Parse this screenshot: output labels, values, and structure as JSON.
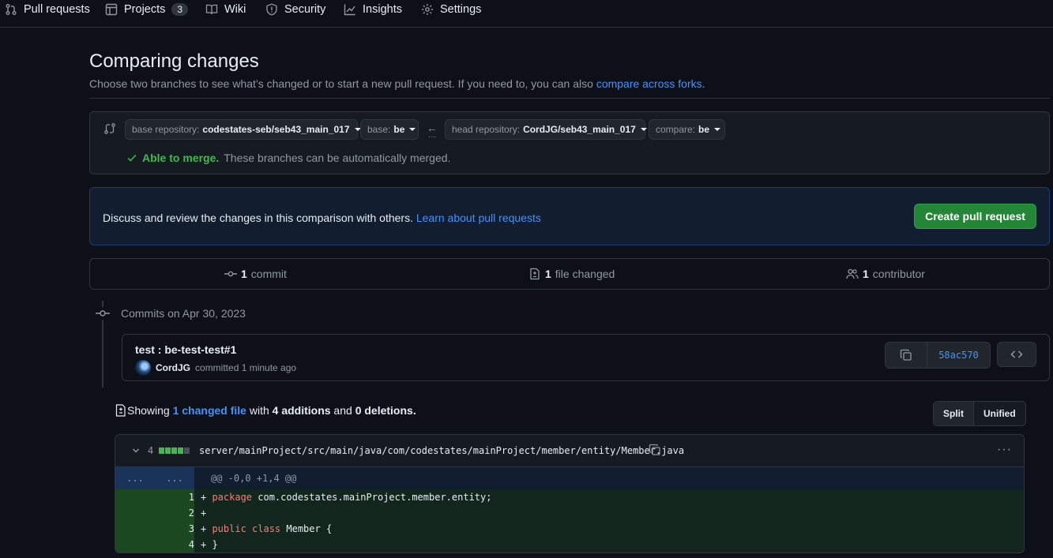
{
  "nav": {
    "items": [
      {
        "label": "Pull requests",
        "icon": "git-pull-request-icon"
      },
      {
        "label": "Projects",
        "icon": "table-icon",
        "count": "3"
      },
      {
        "label": "Wiki",
        "icon": "book-icon"
      },
      {
        "label": "Security",
        "icon": "shield-icon"
      },
      {
        "label": "Insights",
        "icon": "graph-icon"
      },
      {
        "label": "Settings",
        "icon": "gear-icon"
      }
    ]
  },
  "header": {
    "title": "Comparing changes",
    "desc": "Choose two branches to see what’s changed or to start a new pull request. If you need to, you can also ",
    "desc_link": "compare across forks",
    "desc_end": "."
  },
  "range": {
    "base_repo_label": "base repository: ",
    "base_repo": "codestates-seb/seb43_main_017",
    "base_label": "base: ",
    "base": "be",
    "head_repo_label": "head repository: ",
    "head_repo": "CordJG/seb43_main_017",
    "compare_label": "compare: ",
    "compare": "be",
    "merge_ok": "Able to merge.",
    "merge_text": "These branches can be automatically merged."
  },
  "flash": {
    "text": "Discuss and review the changes in this comparison with others. ",
    "link": "Learn about pull requests",
    "button": "Create pull request"
  },
  "summary": {
    "commits_num": "1",
    "commits_label": "commit",
    "files_num": "1",
    "files_label": "file changed",
    "contrib_num": "1",
    "contrib_label": "contributor"
  },
  "commits": {
    "heading": "Commits on Apr 30, 2023",
    "title": "test : be-test-test#1",
    "author": "CordJG",
    "meta": "committed 1 minute ago",
    "sha": "58ac570"
  },
  "toc": {
    "showing": "Showing ",
    "changed_link": "1 changed file",
    "with": " with ",
    "additions": "4 additions",
    "and": " and ",
    "deletions": "0 deletions",
    "end": "."
  },
  "toggle": {
    "split": "Split",
    "unified": "Unified"
  },
  "file": {
    "count": "4",
    "path": "server/mainProject/src/main/java/com/codestates/mainProject/member/entity/Member.java",
    "hunk_old": "...",
    "hunk_new": "...",
    "hunk": "@@ -0,0 +1,4 @@",
    "lines": [
      {
        "num": "1",
        "sign": "+ ",
        "kw": "package",
        "rest": " com.codestates.mainProject.member.entity;"
      },
      {
        "num": "2",
        "sign": "+",
        "kw": "",
        "rest": ""
      },
      {
        "num": "3",
        "sign": "+ ",
        "kw": "public class",
        "rest": " Member {"
      },
      {
        "num": "4",
        "sign": "+ ",
        "kw": "",
        "rest": "}"
      }
    ],
    "diffstat_colors": [
      "#3fb950",
      "#3fb950",
      "#3fb950",
      "#3fb950",
      "#484f58"
    ]
  }
}
